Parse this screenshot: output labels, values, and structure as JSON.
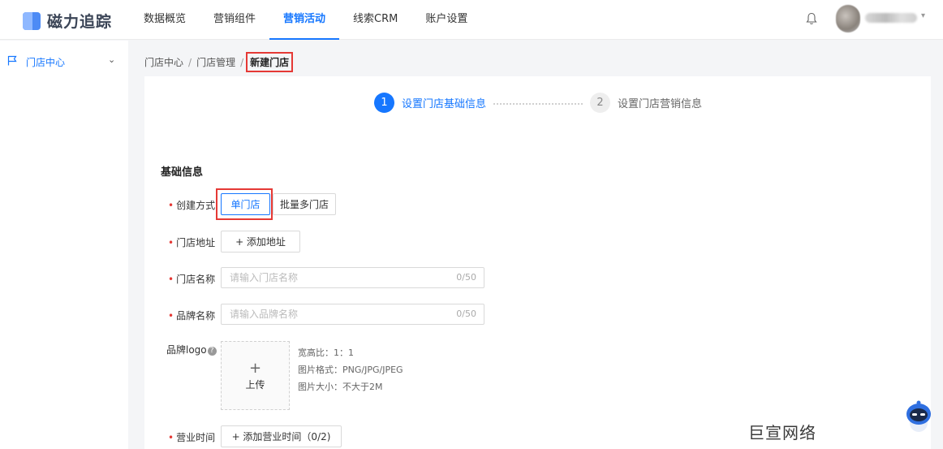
{
  "app": {
    "name": "磁力追踪"
  },
  "nav": [
    {
      "label": "数据概览",
      "active": false
    },
    {
      "label": "营销组件",
      "active": false
    },
    {
      "label": "营销活动",
      "active": true
    },
    {
      "label": "线索CRM",
      "active": false
    },
    {
      "label": "账户设置",
      "active": false
    }
  ],
  "sidebar": {
    "items": [
      {
        "label": "门店中心",
        "icon": "flag-icon"
      }
    ]
  },
  "breadcrumb": {
    "items": [
      "门店中心",
      "门店管理"
    ],
    "separator": "/",
    "current": "新建门店"
  },
  "steps": [
    {
      "num": "1",
      "label": "设置门店基础信息",
      "active": true
    },
    {
      "num": "2",
      "label": "设置门店营销信息",
      "active": false
    }
  ],
  "form": {
    "section_title": "基础信息",
    "create_method": {
      "label": "创建方式",
      "options": [
        "单门店",
        "批量多门店"
      ],
      "selected": "单门店"
    },
    "address": {
      "label": "门店地址",
      "button": "+ 添加地址"
    },
    "store_name": {
      "label": "门店名称",
      "placeholder": "请输入门店名称",
      "count": "0/50"
    },
    "brand_name": {
      "label": "品牌名称",
      "placeholder": "请输入品牌名称",
      "count": "0/50"
    },
    "brand_logo": {
      "label": "品牌logo",
      "upload_plus": "+",
      "upload_text": "上传",
      "hints": [
        "宽高比：1：1",
        "图片格式：PNG/JPG/JPEG",
        "图片大小：不大于2M"
      ]
    },
    "business_hours": {
      "label": "营业时间",
      "button": "+ 添加营业时间（0/2)"
    }
  },
  "watermark": "巨宣网络",
  "colors": {
    "primary": "#1677ff",
    "required": "#e53935",
    "highlight_box": "#e53935"
  }
}
